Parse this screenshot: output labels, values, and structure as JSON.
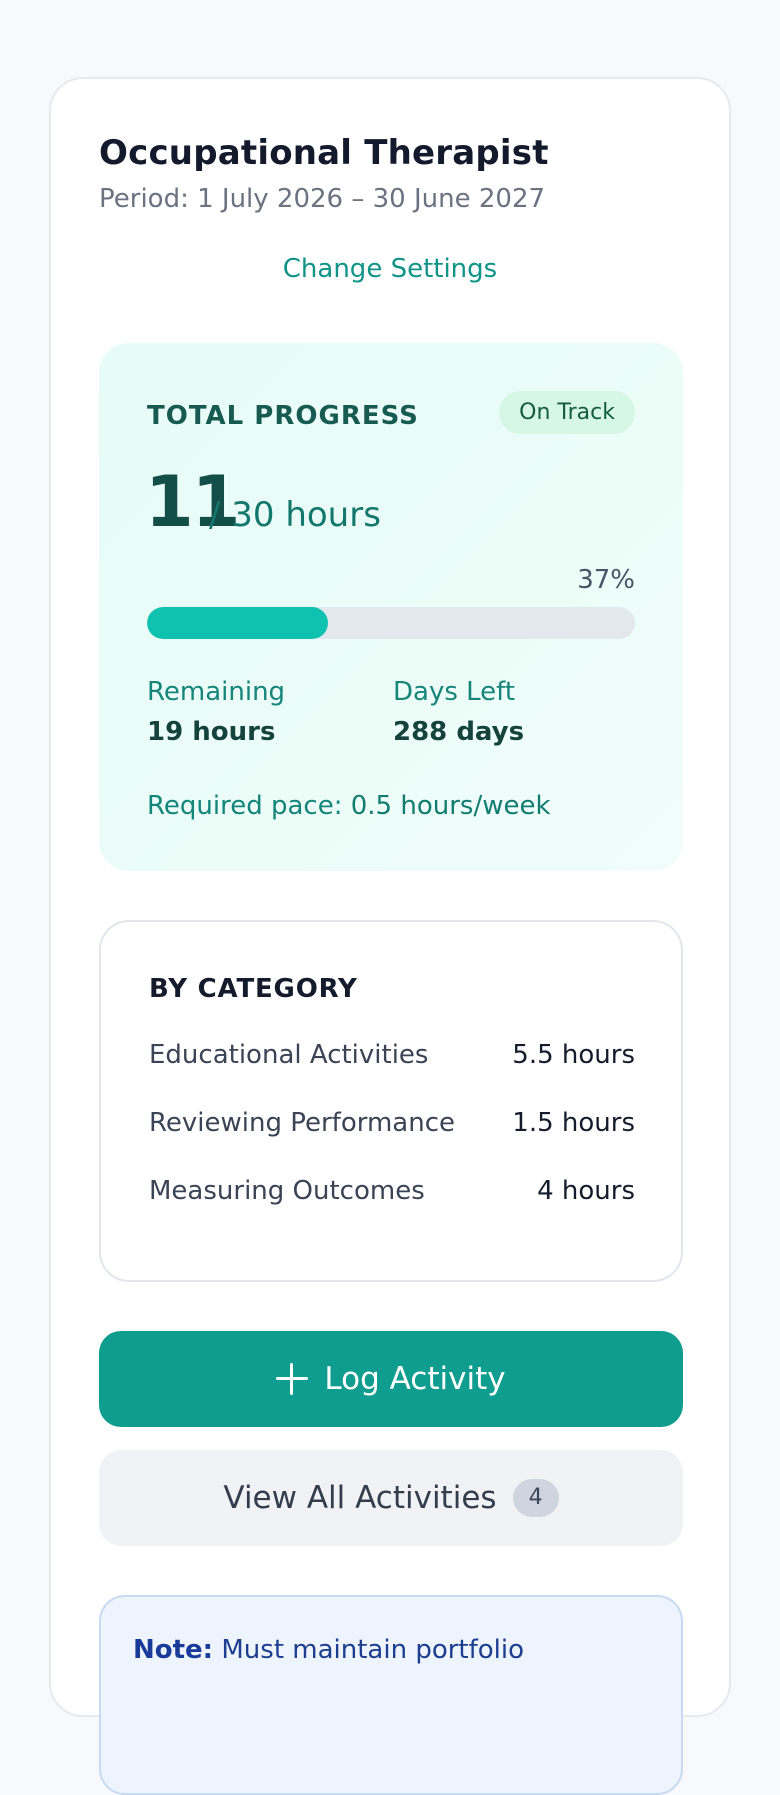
{
  "header": {
    "title": "Occupational Therapist",
    "period": "Period: 1 July 2026 – 30 June 2027",
    "change_settings_label": "Change Settings"
  },
  "progress": {
    "label": "TOTAL PROGRESS",
    "status_badge": "On Track",
    "completed_hours": "11",
    "total_text": "/ 30 hours",
    "percent_text": "37%",
    "percent_value": 37,
    "remaining_label": "Remaining",
    "remaining_value": "19 hours",
    "days_left_label": "Days Left",
    "days_left_value": "288 days",
    "pace_label": "Required pace:",
    "pace_value": "0.5 hours/week"
  },
  "categories": {
    "title": "BY CATEGORY",
    "items": [
      {
        "name": "Educational Activities",
        "hours": "5.5 hours"
      },
      {
        "name": "Reviewing Performance",
        "hours": "1.5 hours"
      },
      {
        "name": "Measuring Outcomes",
        "hours": "4 hours"
      }
    ]
  },
  "actions": {
    "log_label": "Log Activity",
    "view_label": "View All Activities",
    "view_count": "4"
  },
  "note": {
    "label": "Note:",
    "text": "Must maintain portfolio"
  },
  "colors": {
    "accent": "#0e9d8f",
    "progress_fill": "#0fc2b0",
    "badge_bg": "#d6f7e4",
    "note_bg": "#edf4fd"
  }
}
